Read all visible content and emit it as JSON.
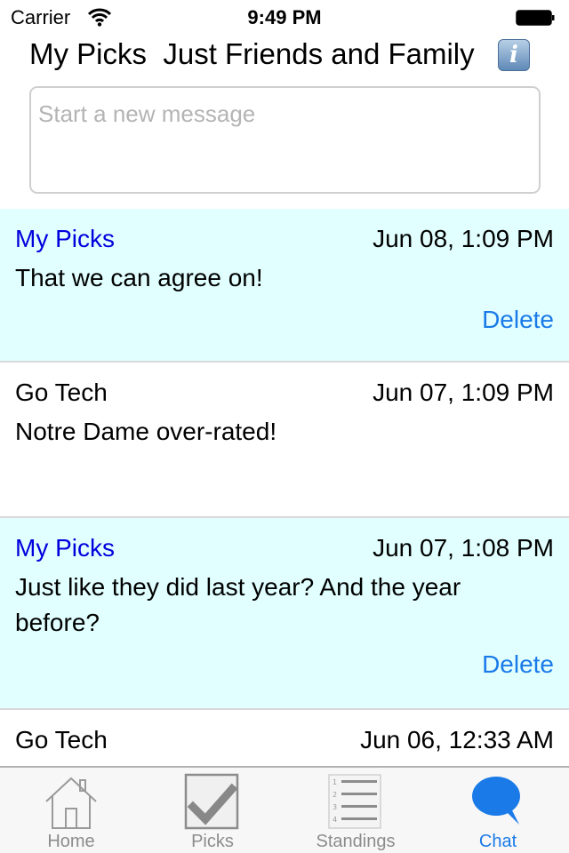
{
  "status_bar": {
    "carrier": "Carrier",
    "time": "9:49 PM"
  },
  "header": {
    "title": "My Picks  Just Friends and Family",
    "info_icon": "info-icon"
  },
  "composer": {
    "placeholder": "Start a new message",
    "value": ""
  },
  "messages": [
    {
      "author": "My Picks",
      "date": "Jun 08, 1:09 PM",
      "body": "That we can agree on!",
      "mine": true,
      "delete_label": "Delete"
    },
    {
      "author": "Go Tech",
      "date": "Jun 07, 1:09 PM",
      "body": "Notre Dame over-rated!",
      "mine": false
    },
    {
      "author": "My Picks",
      "date": "Jun 07, 1:08 PM",
      "body": "Just like they did last year?  And the year before?",
      "mine": true,
      "delete_label": "Delete"
    },
    {
      "author": "Go Tech",
      "date": "Jun 06, 12:33 AM",
      "body": "",
      "mine": false
    }
  ],
  "tabbar": {
    "items": [
      {
        "label": "Home",
        "icon": "home-icon",
        "active": false
      },
      {
        "label": "Picks",
        "icon": "checkmark-icon",
        "active": false
      },
      {
        "label": "Standings",
        "icon": "numbered-list-icon",
        "active": false
      },
      {
        "label": "Chat",
        "icon": "chat-bubble-icon",
        "active": true
      }
    ]
  },
  "colors": {
    "own_message_bg": "#e1ffff",
    "own_author": "#0000dd",
    "accent": "#1a7ae8",
    "inactive_tab": "#8c8c8c"
  }
}
